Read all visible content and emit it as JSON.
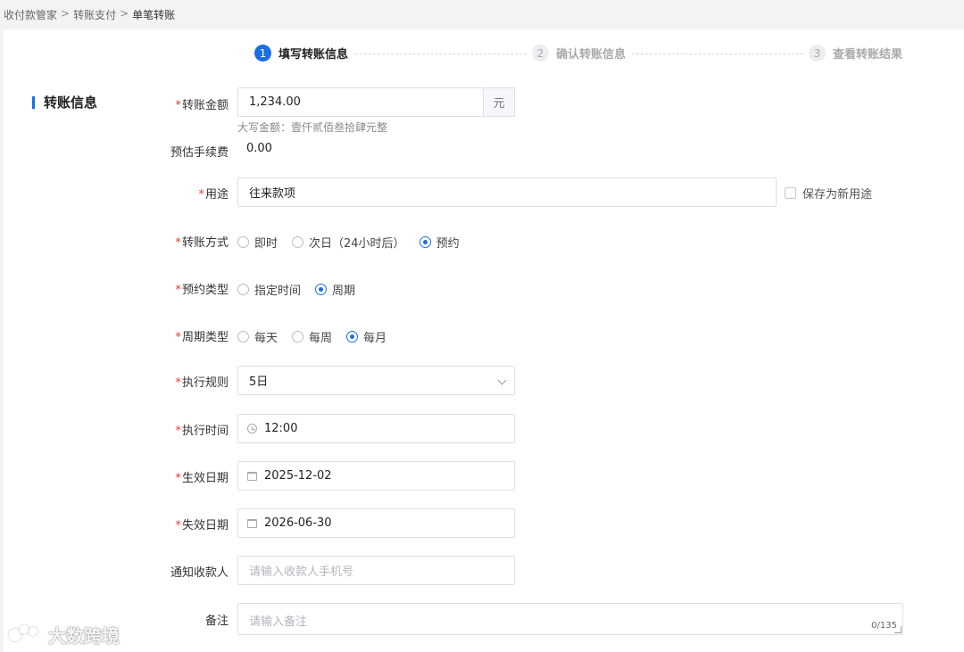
{
  "breadcrumb": {
    "items": [
      "收付款管家",
      "转账支付",
      "单笔转账"
    ],
    "separator": ">"
  },
  "steps": [
    {
      "num": "1",
      "label": "填写转账信息",
      "state": "active"
    },
    {
      "num": "2",
      "label": "确认转账信息",
      "state": "inactive"
    },
    {
      "num": "3",
      "label": "查看转账结果",
      "state": "inactive"
    }
  ],
  "section": {
    "title": "转账信息"
  },
  "form": {
    "amount": {
      "label": "转账金额",
      "value": "1,234.00",
      "unit": "元",
      "hint": "大写金额：壹仟贰佰叁拾肆元整"
    },
    "fee": {
      "label": "预估手续费",
      "value": "0.00"
    },
    "purpose": {
      "label": "用途",
      "value": "往来款项",
      "save_label": "保存为新用途"
    },
    "transfer_method": {
      "label": "转账方式",
      "options": [
        "即时",
        "次日（24小时后）",
        "预约"
      ],
      "selected": "预约"
    },
    "schedule_type": {
      "label": "预约类型",
      "options": [
        "指定时间",
        "周期"
      ],
      "selected": "周期"
    },
    "cycle_type": {
      "label": "周期类型",
      "options": [
        "每天",
        "每周",
        "每月"
      ],
      "selected": "每月"
    },
    "exec_rule": {
      "label": "执行规则",
      "value": "5日"
    },
    "exec_time": {
      "label": "执行时间",
      "value": "12:00"
    },
    "start_date": {
      "label": "生效日期",
      "value": "2025-12-02"
    },
    "end_date": {
      "label": "失效日期",
      "value": "2026-06-30"
    },
    "notify": {
      "label": "通知收款人",
      "placeholder": "请输入收款人手机号"
    },
    "remark": {
      "label": "备注",
      "placeholder": "请输入备注",
      "counter": "0/135"
    }
  },
  "watermark": {
    "text": "大数跨境"
  },
  "colors": {
    "accent": "#1a6ee6",
    "required": "#e23b3b"
  }
}
